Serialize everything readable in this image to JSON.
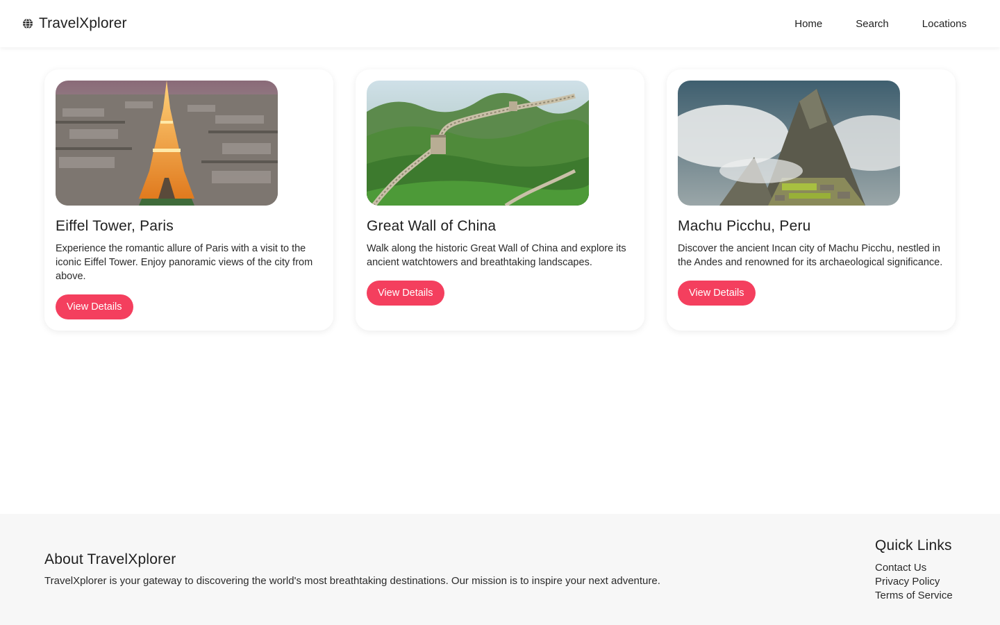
{
  "header": {
    "brand": "TravelXplorer",
    "brand_icon": "globe-icon",
    "nav": [
      {
        "label": "Home"
      },
      {
        "label": "Search"
      },
      {
        "label": "Locations"
      }
    ]
  },
  "cards": [
    {
      "image": "eiffel-tower-photo",
      "title": "Eiffel Tower, Paris",
      "description": "Experience the romantic allure of Paris with a visit to the iconic Eiffel Tower. Enjoy panoramic views of the city from above.",
      "button": "View Details"
    },
    {
      "image": "great-wall-photo",
      "title": "Great Wall of China",
      "description": "Walk along the historic Great Wall of China and explore its ancient watchtowers and breathtaking landscapes.",
      "button": "View Details"
    },
    {
      "image": "machu-picchu-photo",
      "title": "Machu Picchu, Peru",
      "description": "Discover the ancient Incan city of Machu Picchu, nestled in the Andes and renowned for its archaeological significance.",
      "button": "View Details"
    }
  ],
  "footer": {
    "about_title": "About TravelXplorer",
    "about_text": "TravelXplorer is your gateway to discovering the world's most breathtaking destinations. Our mission is to inspire your next adventure.",
    "links_title": "Quick Links",
    "links": [
      "Contact Us",
      "Privacy Policy",
      "Terms of Service"
    ]
  },
  "colors": {
    "accent": "#f43f5e",
    "footer_bg": "#f7f7f7",
    "text": "#1f1f1f"
  }
}
